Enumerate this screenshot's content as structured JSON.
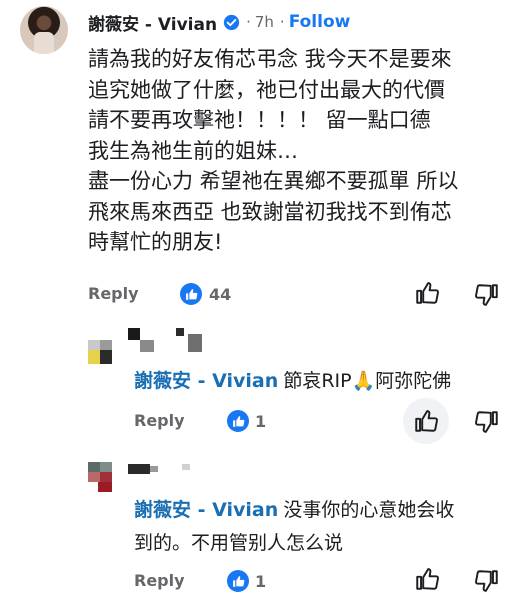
{
  "comment": {
    "author": "謝薇安 - Vivian",
    "time": "7h",
    "follow_label": "Follow",
    "text_lines": [
      "請為我的好友侑芯弔念 我今天不是要來",
      "追究她做了什麼，祂已付出最大的代價",
      "請不要再攻擊祂！！！！ 留一點口德",
      "我生為祂生前的姐妹…",
      "盡一份心力 希望祂在異鄉不要孤單 所以",
      "飛來馬來西亞 也致謝當初我找不到侑芯",
      "時幫忙的朋友!"
    ],
    "reply_label": "Reply",
    "like_count": "44"
  },
  "replies": [
    {
      "mention": "謝薇安 - Vivian",
      "text_first": "節哀RIP🙏阿弥陀佛",
      "text_second": "",
      "reply_label": "Reply",
      "like_count": "1"
    },
    {
      "mention": "謝薇安 - Vivian",
      "text_first": "没事你的心意她会收",
      "text_second": "到的。不用管别人怎么说",
      "reply_label": "Reply",
      "like_count": "1"
    }
  ],
  "colors": {
    "accent": "#1877f2",
    "mention": "#1a6fb3",
    "muted": "#65676b"
  },
  "icons": [
    "verified-badge-icon",
    "like-badge-icon",
    "thumbs-up-icon",
    "thumbs-down-icon"
  ]
}
